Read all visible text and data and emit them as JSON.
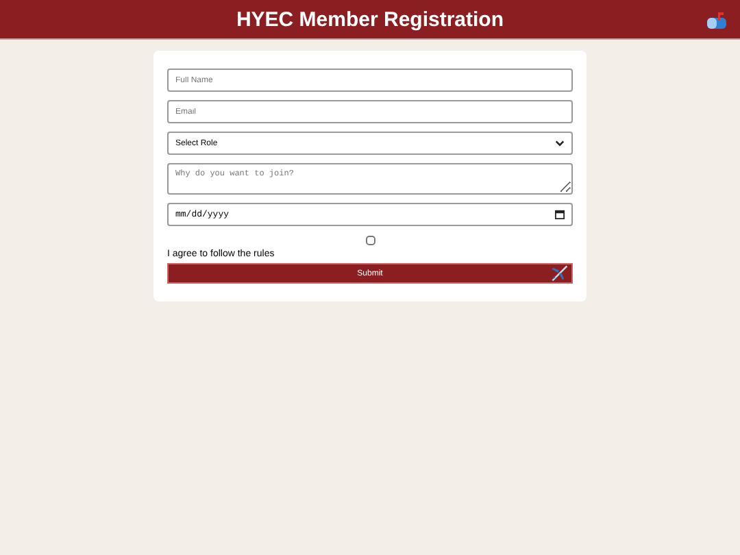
{
  "header": {
    "title": "HYEC Member Registration"
  },
  "form": {
    "full_name": {
      "placeholder": "Full Name"
    },
    "email": {
      "placeholder": "Email"
    },
    "role": {
      "value": "Select Role"
    },
    "reason": {
      "placeholder": "Why do you want to join?"
    },
    "date": {
      "placeholder": "mm/dd/yyyy"
    },
    "agree": {
      "checked": false,
      "label": "I agree to follow the rules"
    },
    "submit": "Submit"
  }
}
